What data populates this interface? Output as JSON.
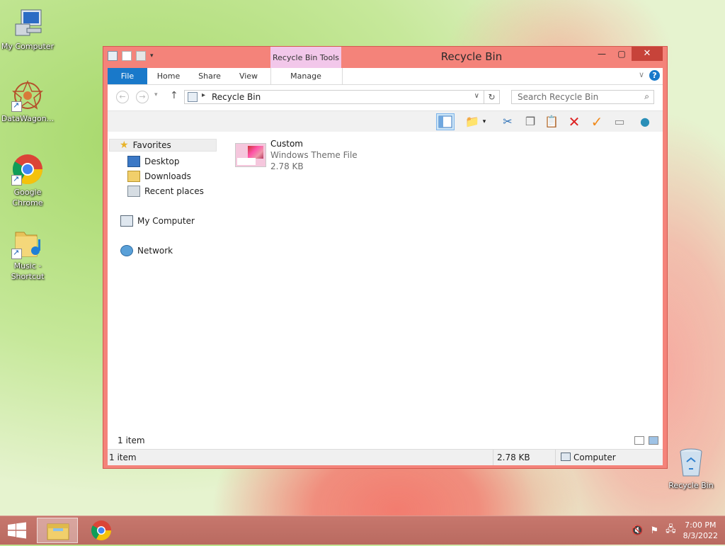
{
  "desktop": {
    "icons": [
      {
        "label": "My Computer"
      },
      {
        "label": "DataWagon..."
      },
      {
        "label": "Google Chrome"
      },
      {
        "label": "Music - Shortcut"
      },
      {
        "label": "Recycle Bin"
      }
    ]
  },
  "window": {
    "title": "Recycle Bin",
    "contextual_tab": "Recycle Bin Tools",
    "ribbon_tabs": [
      "File",
      "Home",
      "Share",
      "View",
      "Manage"
    ],
    "address": {
      "path": "Recycle Bin"
    },
    "search": {
      "placeholder": "Search Recycle Bin"
    },
    "nav_pane": {
      "favorites_label": "Favorites",
      "favorites": [
        "Desktop",
        "Downloads",
        "Recent places"
      ],
      "computer_label": "My Computer",
      "network_label": "Network"
    },
    "files": [
      {
        "name": "Custom",
        "type": "Windows Theme File",
        "size": "2.78 KB"
      }
    ],
    "item_count": "1 item",
    "status": {
      "items": "1 item",
      "size": "2.78 KB",
      "location": "Computer"
    }
  },
  "taskbar": {
    "time": "7:00 PM",
    "date": "8/3/2022"
  },
  "colors": {
    "window_frame": "#f4837a",
    "file_tab": "#1979ca",
    "context_tab": "#f2c7ea",
    "close_button": "#c7433a"
  }
}
